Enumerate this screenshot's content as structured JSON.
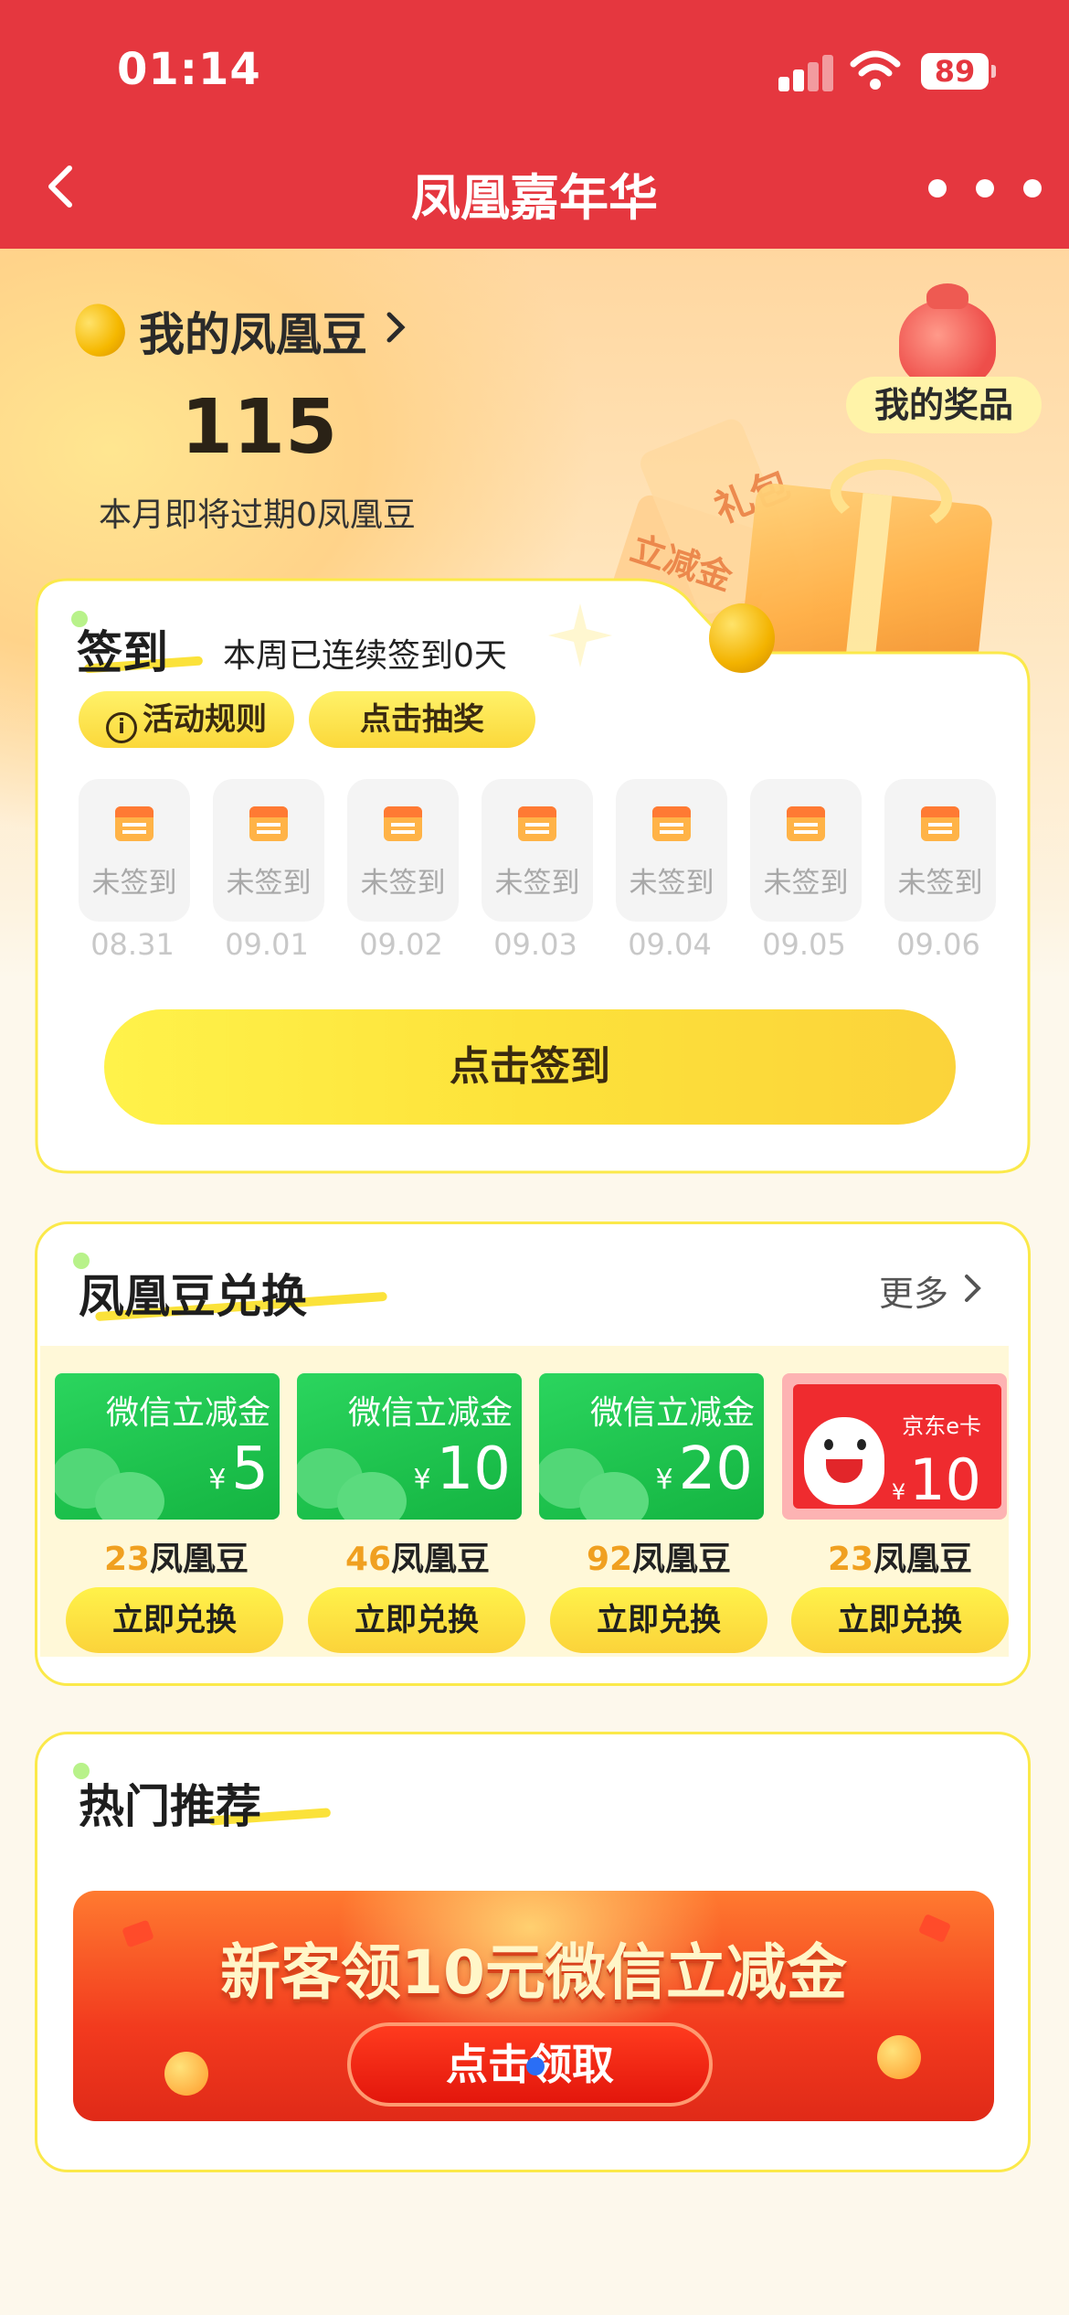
{
  "status_bar": {
    "time": "01:14",
    "battery": "89"
  },
  "nav": {
    "title": "凤凰嘉年华"
  },
  "hero": {
    "my_beans_label": "我的凤凰豆",
    "bean_count": "115",
    "expire_text": "本月即将过期0凤凰豆",
    "my_prizes_label": "我的奖品",
    "decor_ticket_1": "立减金",
    "decor_ticket_2": "礼包"
  },
  "signin": {
    "title": "签到",
    "streak_text": "本周已连续签到0天",
    "rules_label": "活动规则",
    "lottery_label": "点击抽奖",
    "days": [
      {
        "status": "未签到",
        "date": "08.31"
      },
      {
        "status": "未签到",
        "date": "09.01"
      },
      {
        "status": "未签到",
        "date": "09.02"
      },
      {
        "status": "未签到",
        "date": "09.03"
      },
      {
        "status": "未签到",
        "date": "09.04"
      },
      {
        "status": "未签到",
        "date": "09.05"
      },
      {
        "status": "未签到",
        "date": "09.06"
      }
    ],
    "sign_button": "点击签到"
  },
  "exchange": {
    "title": "凤凰豆兑换",
    "more_label": "更多",
    "items": [
      {
        "name": "微信立减金",
        "currency": "¥",
        "value": "5",
        "cost": "23",
        "unit": "凤凰豆",
        "button": "立即兑换"
      },
      {
        "name": "微信立减金",
        "currency": "¥",
        "value": "10",
        "cost": "46",
        "unit": "凤凰豆",
        "button": "立即兑换"
      },
      {
        "name": "微信立减金",
        "currency": "¥",
        "value": "20",
        "cost": "92",
        "unit": "凤凰豆",
        "button": "立即兑换"
      },
      {
        "name": "京东e卡",
        "currency": "¥",
        "value": "10",
        "cost": "23",
        "unit": "凤凰豆",
        "button": "立即兑换"
      }
    ]
  },
  "hot": {
    "title": "热门推荐",
    "banner_title": "新客领10元微信立减金",
    "banner_button": "点击领取"
  }
}
